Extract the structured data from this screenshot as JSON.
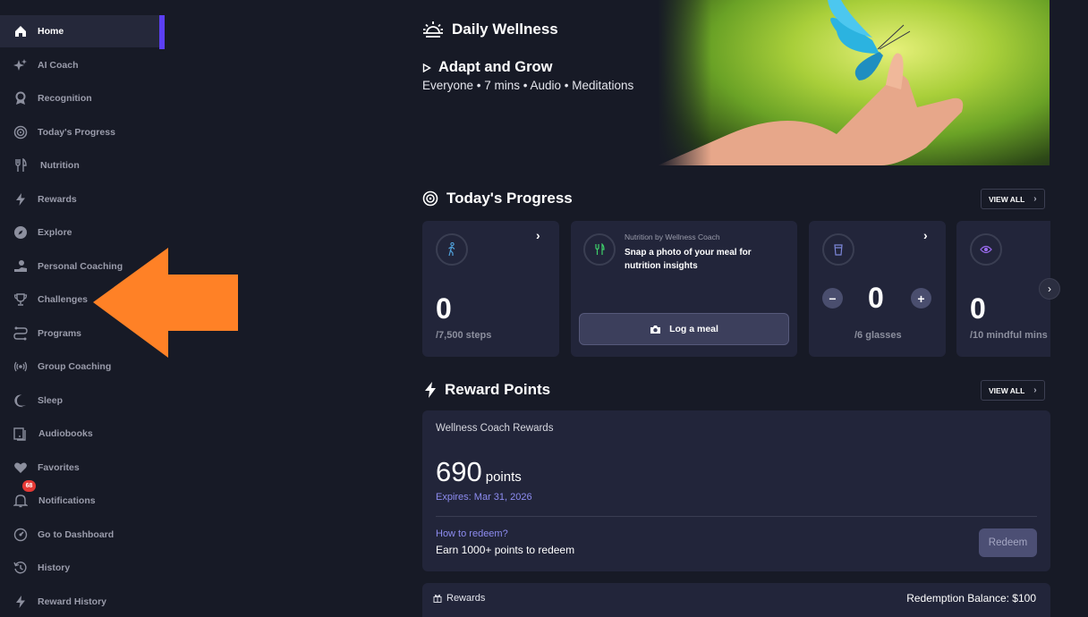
{
  "sidebar": {
    "items": [
      {
        "label": "Home",
        "icon": "home-icon",
        "active": true
      },
      {
        "label": "AI Coach",
        "icon": "sparkle-icon"
      },
      {
        "label": "Recognition",
        "icon": "award-icon"
      },
      {
        "label": "Today's Progress",
        "icon": "target-icon"
      },
      {
        "label": "Nutrition",
        "icon": "utensils-icon"
      },
      {
        "label": "Rewards",
        "icon": "bolt-icon"
      },
      {
        "label": "Explore",
        "icon": "compass-icon"
      },
      {
        "label": "Personal Coaching",
        "icon": "coach-icon"
      },
      {
        "label": "Challenges",
        "icon": "trophy-icon"
      },
      {
        "label": "Programs",
        "icon": "path-icon"
      },
      {
        "label": "Group Coaching",
        "icon": "broadcast-icon"
      },
      {
        "label": "Sleep",
        "icon": "moon-icon"
      },
      {
        "label": "Audiobooks",
        "icon": "book-icon"
      },
      {
        "label": "Favorites",
        "icon": "heart-icon"
      },
      {
        "label": "Notifications",
        "icon": "bell-icon",
        "badge": "68"
      },
      {
        "label": "Go to Dashboard",
        "icon": "dashboard-icon"
      },
      {
        "label": "History",
        "icon": "history-icon"
      },
      {
        "label": "Reward History",
        "icon": "bolt-icon"
      }
    ]
  },
  "wellness": {
    "title": "Daily Wellness",
    "item_title": "Adapt and Grow",
    "item_meta": "Everyone • 7 mins • Audio • Meditations"
  },
  "progress": {
    "title": "Today's Progress",
    "view_all": "VIEW ALL",
    "steps": {
      "value": "0",
      "unit": "/7,500 steps"
    },
    "nutrition": {
      "caption": "Nutrition by Wellness Coach",
      "prompt": "Snap a photo of your meal for nutrition insights",
      "button": "Log a meal"
    },
    "water": {
      "value": "0",
      "unit": "/6 glasses",
      "minus": "−",
      "plus": "+"
    },
    "mindful": {
      "value": "0",
      "unit": "/10 mindful mins"
    }
  },
  "rewards": {
    "title": "Reward Points",
    "view_all": "VIEW ALL",
    "card_title": "Wellness Coach Rewards",
    "points": "690",
    "points_unit": "points",
    "expires": "Expires: Mar 31, 2026",
    "how_to": "How to redeem?",
    "earn_text": "Earn 1000+ points to redeem",
    "redeem_button": "Redeem",
    "footer_label": "Rewards",
    "balance": "Redemption Balance: $100"
  },
  "colors": {
    "accent": "#5b3ff3",
    "arrow": "#ff8126",
    "link": "#8d8cf0",
    "badge": "#e53935"
  }
}
